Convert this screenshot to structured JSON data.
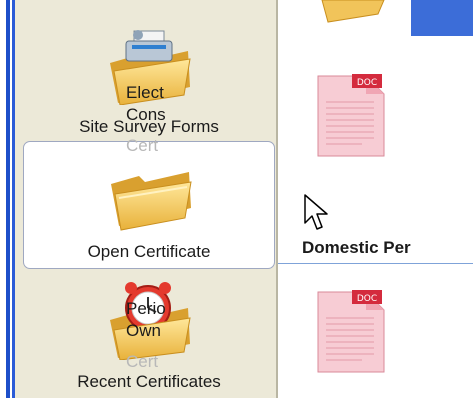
{
  "sidebar": {
    "items": [
      {
        "label": "Site Survey Forms",
        "icon": "folder-printer-icon",
        "selected": false
      },
      {
        "label": "Open Certificate",
        "icon": "folder-icon",
        "selected": true
      },
      {
        "label": "Recent Certificates",
        "icon": "folder-alarm-clock-icon",
        "selected": false
      }
    ]
  },
  "main": {
    "documents": [
      {
        "badge": "DOC",
        "title_line1": "Elect",
        "title_line2": "Cons",
        "subtitle": "Cert"
      },
      {
        "badge": "DOC",
        "title_line1": "Perio",
        "title_line2": "Own",
        "subtitle": "Cert"
      }
    ],
    "section_header": "Domestic Per"
  },
  "colors": {
    "sidebar_bg": "#ece9d8",
    "accent_blue": "#3c6dd8",
    "doc_pink": "#f4c3cc",
    "doc_badge": "#d42b3e"
  }
}
